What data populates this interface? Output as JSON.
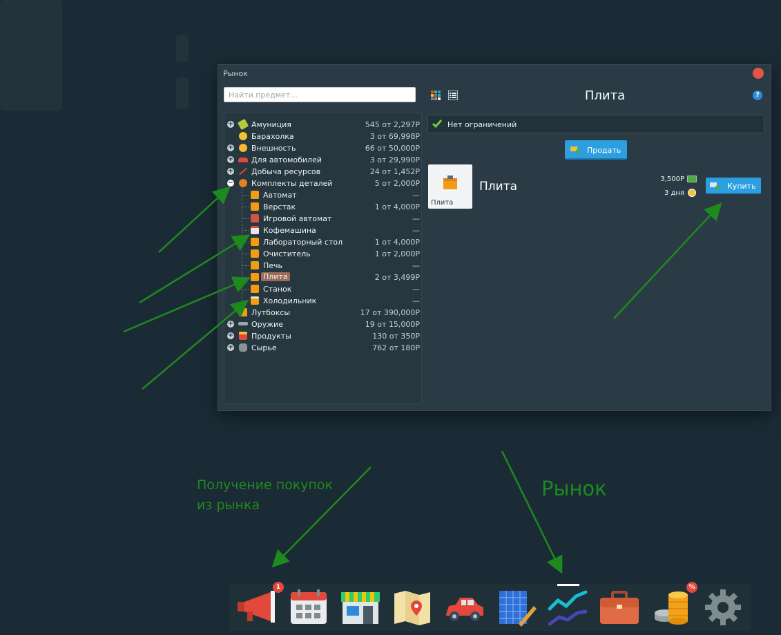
{
  "window": {
    "title": "Рынок",
    "search_placeholder": "Найти предмет...",
    "selected_item_title": "Плита",
    "help_label": "?"
  },
  "tree": {
    "categories": [
      {
        "label": "Амуниция",
        "count": "545 от 2,297Р",
        "toggle": "+",
        "icon": "ammo-icon"
      },
      {
        "label": "Барахолка",
        "count": "3 от 69,998Р",
        "toggle": "",
        "icon": "coin-icon"
      },
      {
        "label": "Внешность",
        "count": "66 от 50,000Р",
        "toggle": "+",
        "icon": "face-icon"
      },
      {
        "label": "Для автомобилей",
        "count": "3 от 29,990Р",
        "toggle": "+",
        "icon": "car-icon"
      },
      {
        "label": "Добыча ресурсов",
        "count": "24 от 1,452Р",
        "toggle": "+",
        "icon": "pickaxe-icon"
      },
      {
        "label": "Комплекты деталей",
        "count": "5 от 2,000Р",
        "toggle": "−",
        "icon": "gears-icon"
      }
    ],
    "subitems": [
      {
        "label": "Автомат",
        "count": "—"
      },
      {
        "label": "Верстак",
        "count": "1 от 4,000Р"
      },
      {
        "label": "Игровой автомат",
        "count": "—"
      },
      {
        "label": "Кофемашина",
        "count": "—"
      },
      {
        "label": "Лабораторный стол",
        "count": "1 от 4,000Р"
      },
      {
        "label": "Очиститель",
        "count": "1 от 2,000Р"
      },
      {
        "label": "Печь",
        "count": "—"
      },
      {
        "label": "Плита",
        "count": "2 от 3,499Р"
      },
      {
        "label": "Станок",
        "count": "—"
      },
      {
        "label": "Холодильник",
        "count": "—"
      }
    ],
    "categories_after": [
      {
        "label": "Лутбоксы",
        "count": "17 от 390,000Р",
        "toggle": "",
        "icon": "box-icon"
      },
      {
        "label": "Оружие",
        "count": "19 от 15,000Р",
        "toggle": "+",
        "icon": "gun-icon"
      },
      {
        "label": "Продукты",
        "count": "130 от 350Р",
        "toggle": "+",
        "icon": "food-icon"
      },
      {
        "label": "Сырье",
        "count": "762 от 180Р",
        "toggle": "+",
        "icon": "ore-icon"
      }
    ]
  },
  "restriction": {
    "text": "Нет ограничений"
  },
  "sell": {
    "label": "Продать"
  },
  "listing": {
    "card_label": "Плита",
    "name": "Плита",
    "price": "3,500Р",
    "duration": "3 дня",
    "buy_label": "Купить"
  },
  "annotations": {
    "purchases_line1": "Получение покупок",
    "purchases_line2": "из рынка",
    "market": "Рынок"
  },
  "taskbar": {
    "items": [
      {
        "name": "megaphone-icon",
        "badge": "1"
      },
      {
        "name": "calendar-icon",
        "badge": ""
      },
      {
        "name": "shop-icon",
        "badge": ""
      },
      {
        "name": "map-icon",
        "badge": ""
      },
      {
        "name": "car-icon",
        "badge": ""
      },
      {
        "name": "blueprint-icon",
        "badge": ""
      },
      {
        "name": "market-chart-icon",
        "badge": ""
      },
      {
        "name": "briefcase-icon",
        "badge": ""
      },
      {
        "name": "coins-icon",
        "badge": "%"
      },
      {
        "name": "settings-gear-icon",
        "badge": ""
      }
    ]
  },
  "colors": {
    "background": "#1b2b35",
    "window": "#2a3b45",
    "accent_button": "#2c9fe0",
    "annotation_green": "#1e8a1e",
    "close_red": "#e25548",
    "selected_row": "#9c6b5a"
  }
}
